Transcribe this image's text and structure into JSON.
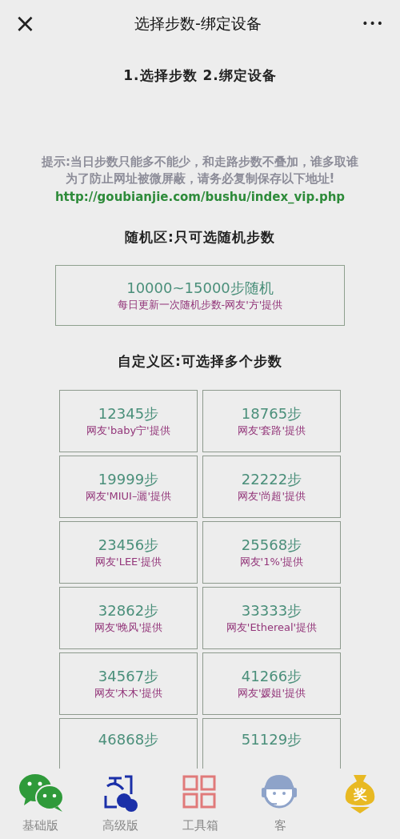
{
  "header": {
    "close": "×",
    "title": "选择步数-绑定设备",
    "more": "•••"
  },
  "steps_heading": "1.选择步数 2.绑定设备",
  "notice": {
    "lines": [
      "提示:当日步数只能多不能少，和走路步数不叠加，谁多取谁",
      "为了防止网址被微屏蔽，请务必复制保存以下地址!"
    ],
    "url": "http://goubianjie.com/bushu/index_vip.php"
  },
  "random_section": {
    "heading": "随机区:只可选随机步数",
    "option": {
      "steps": "10000~15000步随机",
      "credit": "每日更新一次随机步数-网友'方'提供"
    }
  },
  "custom_section": {
    "heading": "自定义区:可选择多个步数",
    "options": [
      {
        "steps": "12345步",
        "credit": "网友'baby宁'提供"
      },
      {
        "steps": "18765步",
        "credit": "网友'套路'提供"
      },
      {
        "steps": "19999步",
        "credit": "网友'MIUI–灑'提供"
      },
      {
        "steps": "22222步",
        "credit": "网友'尚超'提供"
      },
      {
        "steps": "23456步",
        "credit": "网友'LEE'提供"
      },
      {
        "steps": "25568步",
        "credit": "网友'1%'提供"
      },
      {
        "steps": "32862步",
        "credit": "网友'晚风'提供"
      },
      {
        "steps": "33333步",
        "credit": "网友'Ethereal'提供"
      },
      {
        "steps": "34567步",
        "credit": "网友'木木'提供"
      },
      {
        "steps": "41266步",
        "credit": "网友'媛姐'提供"
      },
      {
        "steps": "46868步"
      },
      {
        "steps": "51129步"
      }
    ]
  },
  "tab_bar": [
    {
      "kind": "chat",
      "label": "基础版"
    },
    {
      "kind": "document",
      "label": "高级版"
    },
    {
      "kind": "grid",
      "label": "工具箱"
    },
    {
      "kind": "support",
      "label": "客"
    },
    {
      "kind": "prize",
      "glyph": "奖"
    }
  ]
}
